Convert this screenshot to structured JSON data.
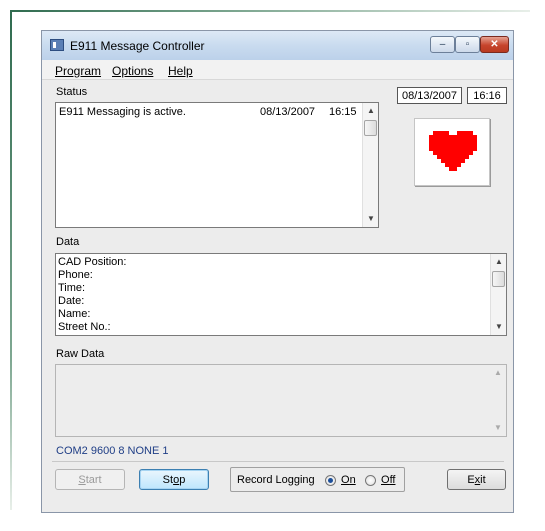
{
  "window": {
    "title": "E911 Message Controller",
    "controls": {
      "minimize": "–",
      "maximize": "▫",
      "close": "✕"
    }
  },
  "menu": [
    {
      "label": "Program"
    },
    {
      "label": "Options"
    },
    {
      "label": "Help"
    }
  ],
  "status": {
    "label": "Status",
    "line": {
      "message": "E911 Messaging is active.",
      "date": "08/13/2007",
      "time": "16:15"
    }
  },
  "clock": {
    "date": "08/13/2007",
    "time": "16:16"
  },
  "heartbeat": {
    "icon": "heart-icon",
    "color": "#ff0000"
  },
  "data_section": {
    "label": "Data",
    "fields": [
      "CAD Position:",
      "Phone:",
      "Time:",
      "Date:",
      "Name:",
      "Street No.:"
    ]
  },
  "raw_data": {
    "label": "Raw Data"
  },
  "port_settings": "COM2 9600 8 NONE 1",
  "buttons": {
    "start": {
      "pre": "",
      "key": "S",
      "post": "tart"
    },
    "stop": {
      "pre": "St",
      "key": "o",
      "post": "p"
    },
    "exit": {
      "pre": "E",
      "key": "x",
      "post": "it"
    }
  },
  "record_logging": {
    "label": "Record Logging",
    "options": [
      {
        "key": "O",
        "rest": "n",
        "selected": true
      },
      {
        "key": "O",
        "rest": "ff",
        "selected": false
      }
    ]
  },
  "scroll_arrows": {
    "up": "▲",
    "down": "▼"
  }
}
